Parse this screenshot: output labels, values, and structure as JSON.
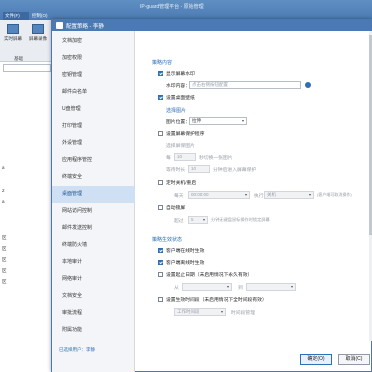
{
  "background_app": {
    "title": "IP-guard管理平台 - 原始管理",
    "tabs": [
      "文件(F)",
      "控制(O)"
    ],
    "toolbar": [
      {
        "label": "实时屏幕"
      },
      {
        "label": "屏幕录像"
      }
    ],
    "search_label": "基础",
    "sidebar_rows": [
      "a",
      "2",
      "a",
      "区",
      "区",
      "区",
      "区",
      "区"
    ]
  },
  "dialog": {
    "title": "配置策略 - 李静",
    "nav_items": [
      "文档加密",
      "加密权限",
      "密钥管理",
      "邮件白名单",
      "U盘管理",
      "打印管理",
      "外设管理",
      "应用程序管控",
      "终端安全",
      "桌面管理",
      "网站访问控制",
      "邮件发送控制",
      "终端防火墙",
      "本地审计",
      "网络审计",
      "文档安全",
      "审批流程",
      "附属功能"
    ],
    "nav_active_index": 9,
    "nav_footer": "已选择用户：李静",
    "content": {
      "section1_head": "策略内容",
      "show_window_label": "显示屏幕水印",
      "watermark_content_label": "水印内容：",
      "watermark_content_placeholder": "点击右侧按钮配置",
      "set_desktop_wallpaper_label": "设置桌面壁纸",
      "choose_image_head": "选择图片",
      "image_position_label": "图片位置：",
      "image_position_value": "拉伸",
      "set_screensaver_label": "设置屏幕保护程序",
      "choose_screensaver_head": "选择屏保图片",
      "every_label": "每",
      "every_value": "10",
      "seconds_switch_label": "秒切换一张图片",
      "wait_label": "等待时长",
      "wait_value": "10",
      "minutes_enter_label": "分钟后进入屏幕保护",
      "scheduled_shutdown_label": "定时关机/重启",
      "daily_label": "每天",
      "daily_time_value": "00:00:00",
      "execute_label": "执行",
      "execute_value": "关机",
      "execute_suffix": "(客户端可取消操作)",
      "auto_lock_label": "自动锁屏",
      "idle_label": "超过",
      "idle_value": "5",
      "idle_suffix": "分钟无键盘鼠标操作时锁定屏幕",
      "section2_head": "策略生效状态",
      "client_online_label": "客户端在线时生效",
      "client_offline_label": "客户端离线时生效",
      "set_effective_date_label": "设置起止日期（未启用情况下永久有效）",
      "date_from_label": "从",
      "date_to_label": "到",
      "set_effective_time_label": "设置生效时间段（未启用情况下全时间段有效）",
      "time_select_value": "工作时间段",
      "time_manage_label": "时间段管理"
    },
    "buttons": {
      "ok": "确定(O)",
      "cancel": "取消(C)"
    }
  }
}
